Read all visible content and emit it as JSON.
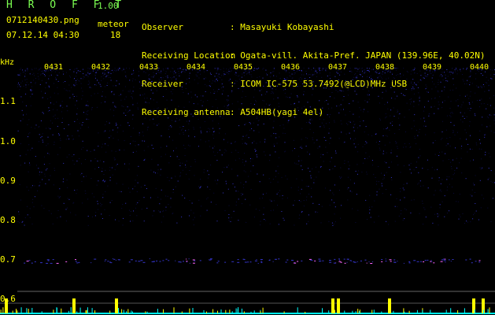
{
  "header": {
    "app_title": "H R O F F T",
    "version": "1.00",
    "filename": "0712140430.png",
    "meteor_label": "meteor",
    "datetime": "07.12.14 04:30",
    "meteor_count": "18"
  },
  "info": {
    "rows": [
      {
        "key": "Observer",
        "value": ": Masayuki Kobayashi"
      },
      {
        "key": "Receiving Location",
        "value": ": Ogata-vill. Akita-Pref. JAPAN (139.96E, 40.02N)"
      },
      {
        "key": "Receiver",
        "value": ": ICOM IC-575 53.7492(@LCD)MHz USB"
      },
      {
        "key": "Receiving antenna",
        "value": ": A504HB(yagi 4el)"
      }
    ]
  },
  "spectrogram": {
    "freq_unit": "kHz",
    "time_labels": [
      "0431",
      "0432",
      "0433",
      "0434",
      "0435",
      "0436",
      "0437",
      "0438",
      "0439",
      "0440"
    ],
    "freq_labels": [
      "1.1",
      "1.0",
      "0.9",
      "0.8",
      "0.7",
      "0.6"
    ],
    "colors": {
      "noise_dark": "#0a0a3a",
      "noise_bright": "#3434c8",
      "signal": "#ff66ff",
      "trace": "#ffff00",
      "baseline": "#00ffff"
    }
  }
}
